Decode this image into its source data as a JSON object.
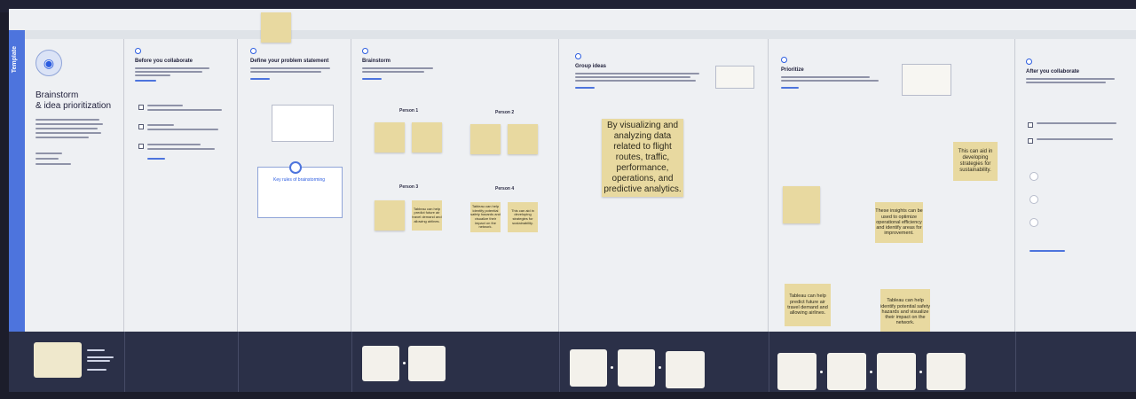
{
  "board": {
    "side_label": "Template"
  },
  "intro": {
    "title_line1": "Brainstorm",
    "title_line2": "& idea prioritization"
  },
  "sections": {
    "before": "Before you collaborate",
    "define": "Define your problem statement",
    "brainstorm": "Brainstorm",
    "group": "Group ideas",
    "prioritize": "Prioritize",
    "after": "After you collaborate"
  },
  "brainstorm": {
    "person1": "Person 1",
    "person2": "Person 2",
    "person3": "Person 3",
    "person4": "Person 4",
    "tips_title": "Key rules of brainstorming"
  },
  "stickies": {
    "group_big": "By visualizing and analyzing data related to flight routes, traffic, performance, operations, and predictive analytics.",
    "group_small_right": "This can aid in developing strategies for sustainability.",
    "prio_insights": "These insights can be used to optimize operational efficiency and identify areas for improvement.",
    "prio_predict": "Tableau can help predict future air travel demand and allowing airlines.",
    "prio_hazards": "Tableau can help identify potential safety hazards and visualize their impact on the network.",
    "p4_aid": "This can aid in developing strategies for sustainability.",
    "p3_predict": "Tableau can help predict future air travel demand and allowing airlines.",
    "p4_hazards": "Tableau can help identify potential safety hazards and visualize their impact on the network."
  },
  "colors": {
    "accent": "#4d74dd",
    "sticky": "#e8d9a0",
    "board": "#eef0f3",
    "frame": "#2b3048"
  }
}
